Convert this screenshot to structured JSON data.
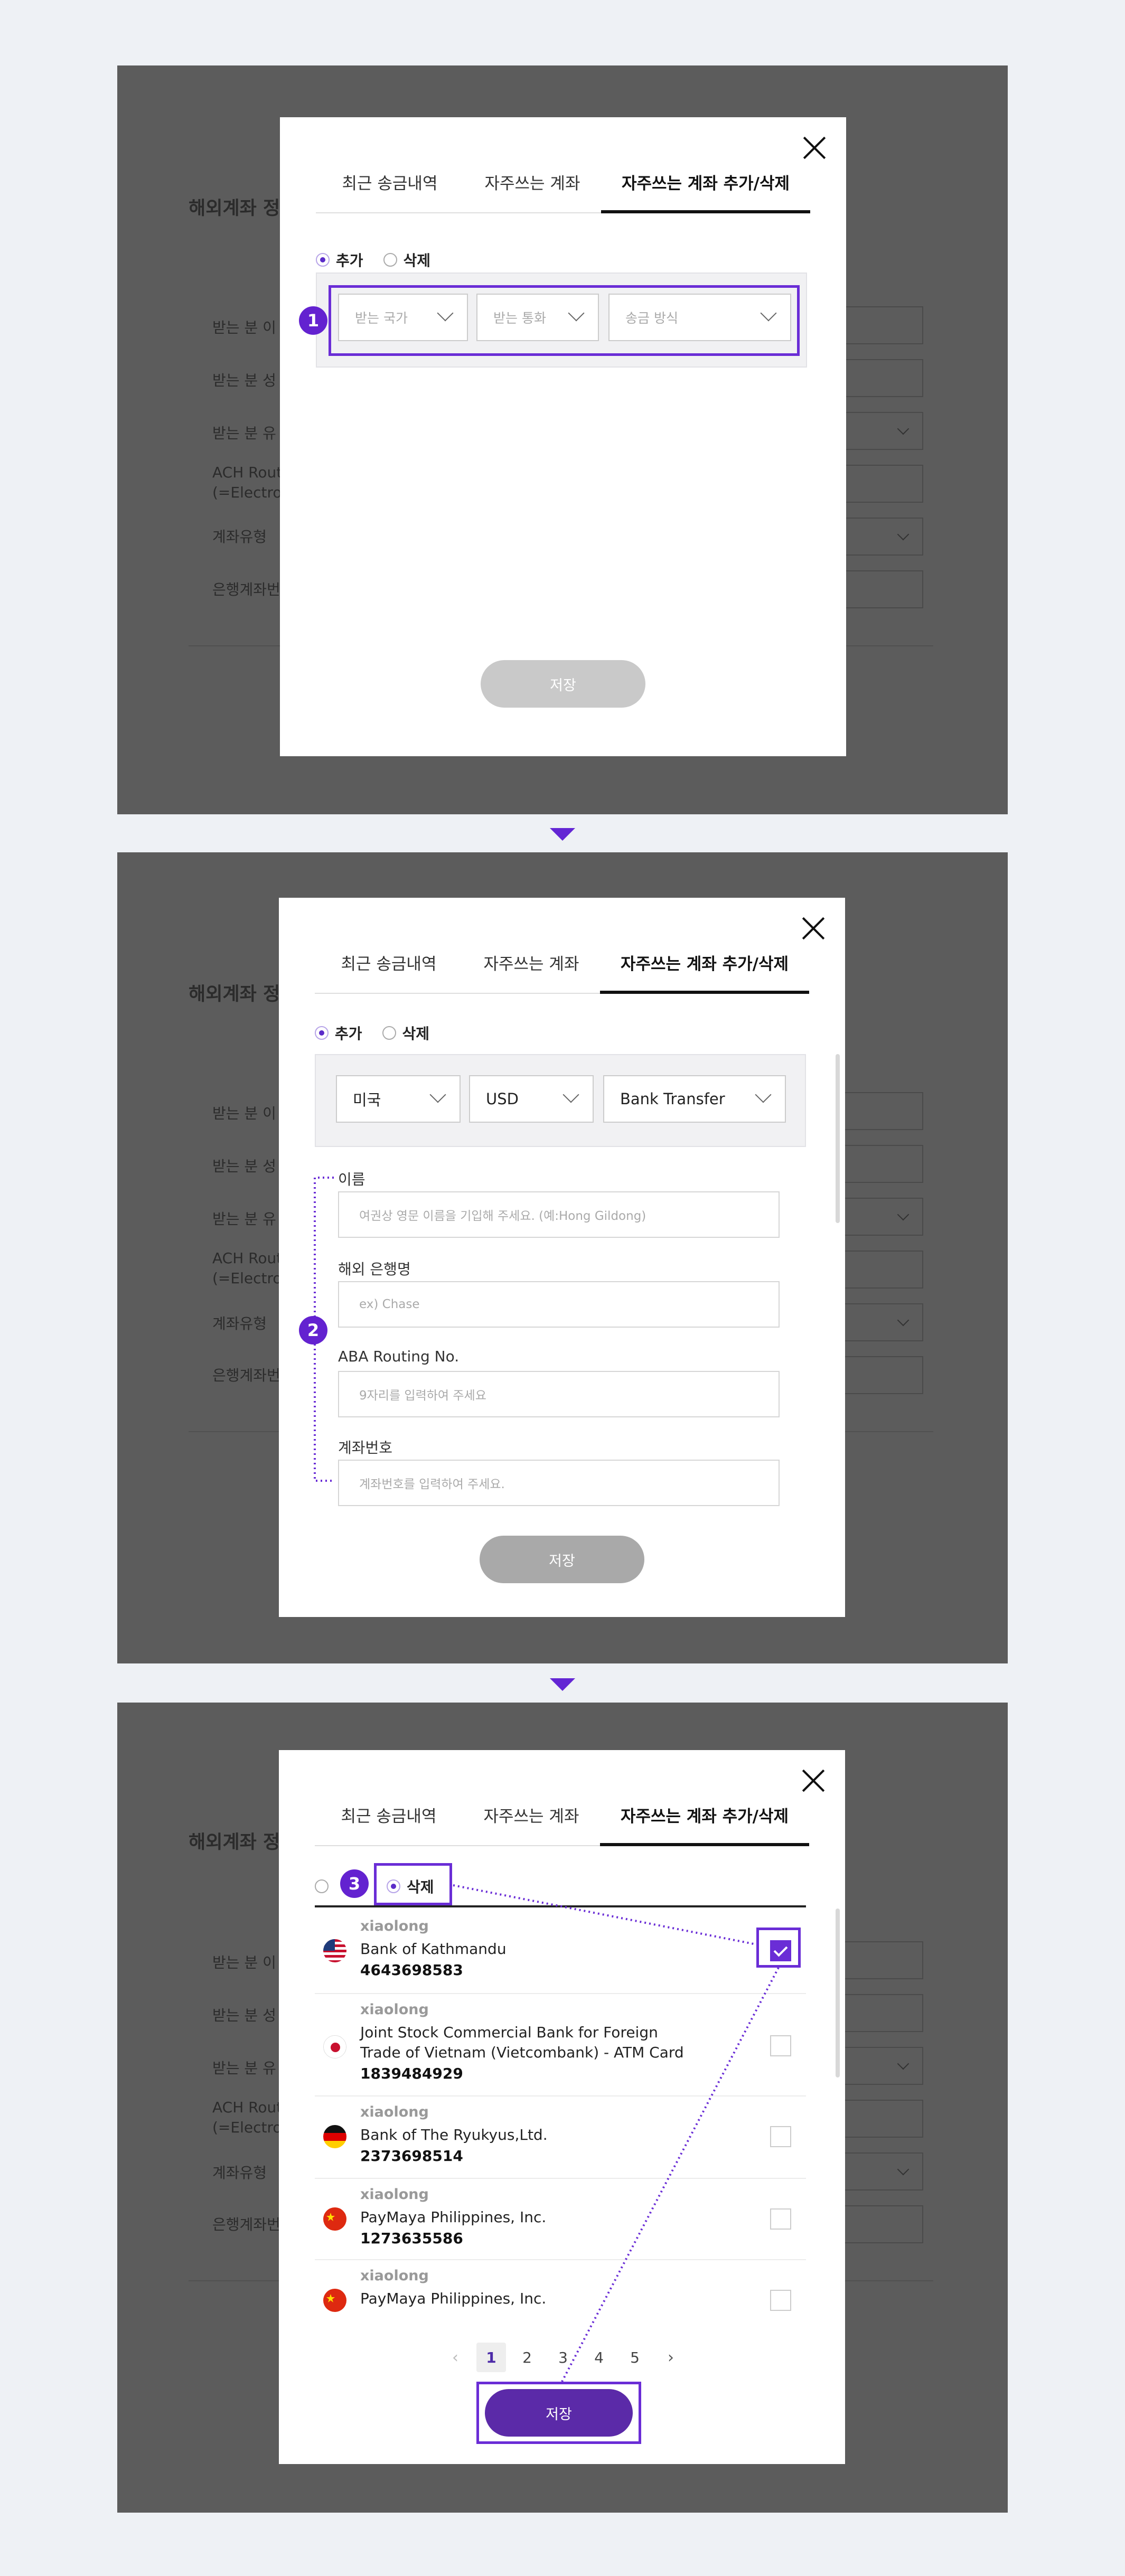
{
  "background": {
    "page_title_partial": "해외계좌 정",
    "labels": [
      "받는 분 이",
      "받는 분 성",
      "받는 분 유",
      "ACH Rout\n(=Electro",
      "계좌유형",
      "은행계좌번"
    ]
  },
  "modal": {
    "tabs": [
      "최근 송금내역",
      "자주쓰는 계좌",
      "자주쓰는 계좌 추가/삭제"
    ],
    "radio_add": "추가",
    "radio_delete": "삭제",
    "save_label": "저장"
  },
  "step1": {
    "badge": "1",
    "select_placeholders": [
      "받는 국가",
      "받는 통화",
      "송금 방식"
    ]
  },
  "step2": {
    "badge": "2",
    "selected_values": [
      "미국",
      "USD",
      "Bank Transfer"
    ],
    "fields": [
      {
        "label": "이름",
        "placeholder": "여권상 영문 이름을 기입해 주세요. (예:Hong Gildong)"
      },
      {
        "label": "해외 은행명",
        "placeholder": "ex) Chase"
      },
      {
        "label": "ABA Routing No.",
        "placeholder": "9자리를 입력하여 주세요"
      },
      {
        "label": "계좌번호",
        "placeholder": "계좌번호를 입력하여 주세요."
      }
    ]
  },
  "step3": {
    "badge": "3",
    "accounts": [
      {
        "owner": "xiaolong",
        "bank": "Bank of Kathmandu",
        "number": "4643698583",
        "flag": "us-flag-icon",
        "checked": true
      },
      {
        "owner": "xiaolong",
        "bank": "Joint Stock Commercial Bank for Foreign Trade of Vietnam (Vietcombank) - ATM Card",
        "number": "1839484929",
        "flag": "jp-flag-icon",
        "checked": false
      },
      {
        "owner": "xiaolong",
        "bank": "Bank of The Ryukyus,Ltd.",
        "number": "2373698514",
        "flag": "de-flag-icon",
        "checked": false
      },
      {
        "owner": "xiaolong",
        "bank": "PayMaya Philippines, Inc.",
        "number": "1273635586",
        "flag": "cn-flag-icon",
        "checked": false
      },
      {
        "owner": "xiaolong",
        "bank": "PayMaya Philippines, Inc.",
        "number": "",
        "flag": "cn-flag-icon",
        "checked": false
      }
    ],
    "pagination": {
      "prev": "‹",
      "pages": [
        "1",
        "2",
        "3",
        "4",
        "5"
      ],
      "current": "1",
      "next": "›"
    }
  },
  "colors": {
    "accent": "#6a2dd6",
    "save_disabled": "#c9c9c9",
    "save_disabled_2": "#a9a9a9",
    "save_active": "#5b2aa8",
    "dim_overlay": "#5c5c5c",
    "page_bg": "#eef1f5"
  }
}
